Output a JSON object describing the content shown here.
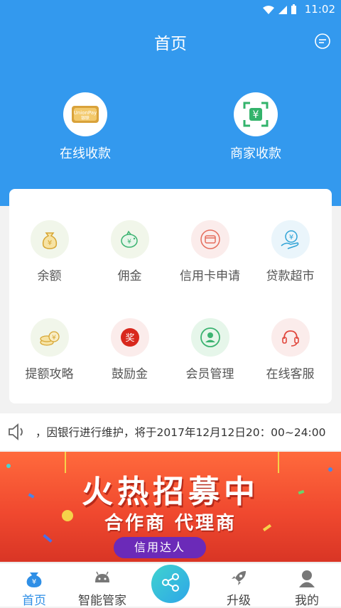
{
  "status": {
    "time": "11:02"
  },
  "header": {
    "title": "首页"
  },
  "quick": [
    {
      "label": "在线收款",
      "icon": "unionpay-card-icon"
    },
    {
      "label": "商家收款",
      "icon": "qr-scan-yuan-icon"
    }
  ],
  "grid": [
    {
      "label": "余额",
      "icon": "money-bag-icon"
    },
    {
      "label": "佣金",
      "icon": "piggy-bank-icon"
    },
    {
      "label": "信用卡申请",
      "icon": "credit-card-icon"
    },
    {
      "label": "贷款超市",
      "icon": "hand-coin-icon"
    },
    {
      "label": "提额攻略",
      "icon": "coin-stack-icon"
    },
    {
      "label": "鼓励金",
      "icon": "reward-badge-icon"
    },
    {
      "label": "会员管理",
      "icon": "member-icon"
    },
    {
      "label": "在线客服",
      "icon": "headset-icon"
    }
  ],
  "notice": {
    "text": "，因银行进行维护，将于2017年12月12日20：00~24:00"
  },
  "banner": {
    "headline": "火热招募中",
    "subline": "合作商 代理商",
    "tag": "信用达人"
  },
  "tabs": [
    {
      "label": "首页",
      "icon": "home-yuan-icon",
      "active": true
    },
    {
      "label": "智能管家",
      "icon": "android-robot-icon"
    },
    {
      "label": "",
      "icon": "share-icon"
    },
    {
      "label": "升级",
      "icon": "rocket-icon"
    },
    {
      "label": "我的",
      "icon": "user-icon"
    }
  ],
  "colors": {
    "primary": "#3399ee",
    "accent_green": "#3cb371",
    "tab_active": "#2f8fe6",
    "banner_red": "#f0492f"
  }
}
